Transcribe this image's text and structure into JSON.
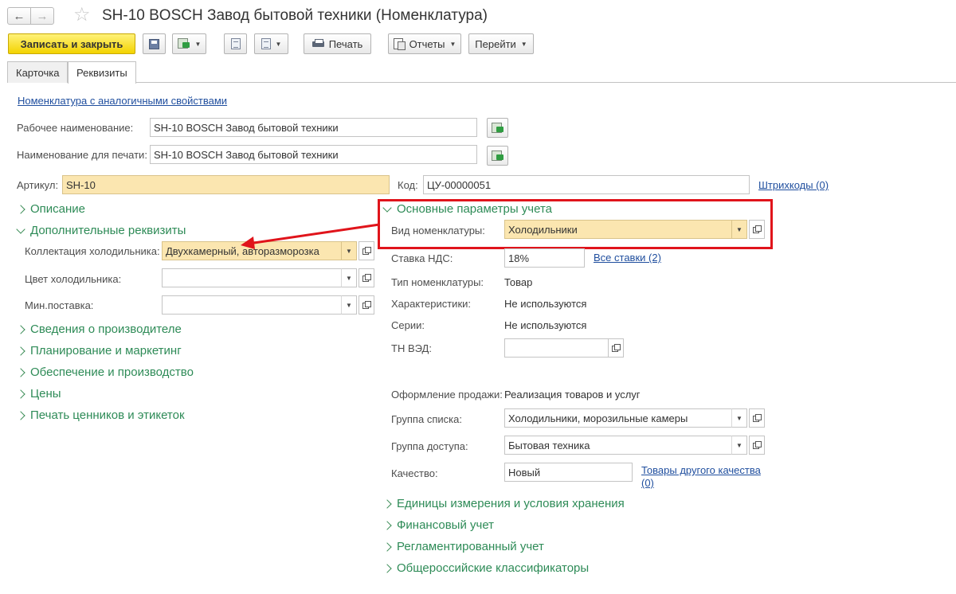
{
  "window": {
    "title": "SH-10 BOSCH Завод бытовой техники (Номенклатура)"
  },
  "toolbar": {
    "save_close": "Записать и закрыть",
    "print": "Печать",
    "reports": "Отчеты",
    "goto": "Перейти"
  },
  "tabs": {
    "card": "Карточка",
    "requisites": "Реквизиты"
  },
  "form": {
    "similar_link": "Номенклатура с аналогичными свойствами",
    "work_name_label": "Рабочее наименование:",
    "work_name_value": "SH-10 BOSCH Завод бытовой техники",
    "print_name_label": "Наименование для печати:",
    "print_name_value": "SH-10 BOSCH Завод бытовой техники",
    "article_label": "Артикул:",
    "article_value": "SH-10",
    "code_label": "Код:",
    "code_value": "ЦУ-00000051",
    "barcodes_link": "Штрихкоды (0)"
  },
  "left_groups": {
    "description": "Описание",
    "additional": "Дополнительные реквизиты",
    "fridge_collection_label": "Коллектация холодильника:",
    "fridge_collection_value": "Двухкамерный, авторазморозка",
    "fridge_color_label": "Цвет холодильника:",
    "fridge_color_value": "",
    "min_supply_label": "Мин.поставка:",
    "min_supply_value": "",
    "manufacturer": "Сведения о производителе",
    "planning": "Планирование и маркетинг",
    "supply": "Обеспечение и производство",
    "prices": "Цены",
    "labels": "Печать ценников и этикеток"
  },
  "right_groups": {
    "main_params": "Основные параметры учета",
    "kind_label": "Вид номенклатуры:",
    "kind_value": "Холодильники",
    "vat_label": "Ставка НДС:",
    "vat_value": "18%",
    "all_rates_link": "Все ставки (2)",
    "type_label": "Тип номенклатуры:",
    "type_value": "Товар",
    "characteristics_label": "Характеристики:",
    "characteristics_value": "Не используются",
    "series_label": "Серии:",
    "series_value": "Не используются",
    "tn_ved_label": "ТН ВЭД:",
    "tn_ved_value": "",
    "sale_design_label": "Оформление продажи:",
    "sale_design_value": "Реализация товаров и услуг",
    "list_group_label": "Группа списка:",
    "list_group_value": "Холодильники, морозильные камеры",
    "access_group_label": "Группа доступа:",
    "access_group_value": "Бытовая техника",
    "quality_label": "Качество:",
    "quality_value": "Новый",
    "other_quality_link_1": "Товары другого качества",
    "other_quality_link_2": "(0)",
    "units": "Единицы измерения и условия хранения",
    "financial": "Финансовый учет",
    "regulated": "Регламентированный учет",
    "classifiers": "Общероссийские классификаторы"
  },
  "colors": {
    "primary_button": "#f3d300",
    "group_green": "#2e8b57",
    "link_blue": "#1f4e9e",
    "highlight_input": "#fbe6b0",
    "annotation_red": "#e0141b"
  }
}
